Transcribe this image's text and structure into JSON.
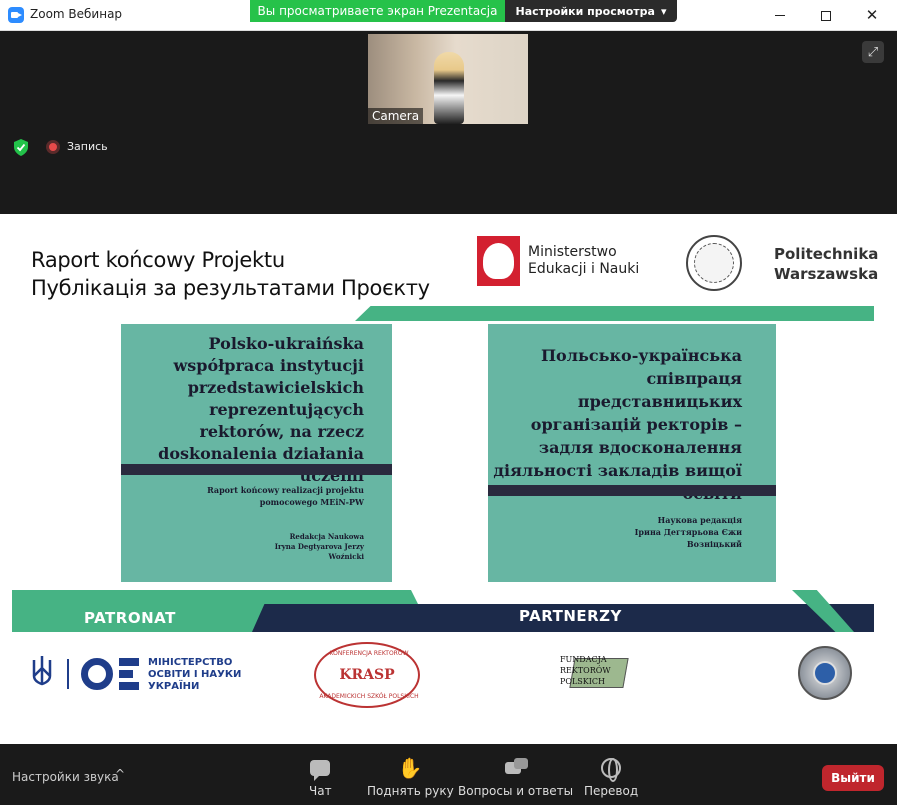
{
  "window": {
    "title": "Zoom Вебинар"
  },
  "share_bar": {
    "viewing_text": "Вы просматриваете экран Prezentacja",
    "view_options_label": "Настройки просмотра",
    "view_options_arrow": "▾"
  },
  "video": {
    "label": "Camera"
  },
  "recording": {
    "label": "Запись"
  },
  "slide": {
    "title_line1": "Raport końcowy Projektu",
    "title_line2": "Публікація за результатами Проєкту",
    "ministry_line1": "Ministerstwo",
    "ministry_line2": "Edukacji i Nauki",
    "pw_line1": "Politechnika",
    "pw_line2": "Warszawska",
    "book_pl": {
      "title": "Polsko-ukraińska współpraca instytucji przedstawicielskich reprezentujących rektorów, na rzecz doskonalenia działania uczelni",
      "subtitle": "Raport końcowy realizacji projektu pomocowego MEiN-PW",
      "editors": "Redakcja Naukowa Iryna Degtyarova Jerzy Woźnicki"
    },
    "book_ua": {
      "title": "Польсько-українська співпраця представницьких організацій ректорів – задля вдосконалення діяльності закладів вищої освіти",
      "editors": "Наукова редакція Ірина Дегтярьова Єжи Возніцький"
    },
    "patronat": "PATRONAT",
    "partnerzy": "PARTNERZY",
    "mon_line1": "МІНІСТЕРСТВО",
    "mon_line2": "ОСВІТИ І НАУКИ",
    "mon_line3": "УКРАЇНИ",
    "krasp": "KRASP",
    "krasp_top": "KONFERENCJA REKTORÓW",
    "krasp_bottom": "AKADEMICKICH SZKÓŁ POLSKICH",
    "frp_text": "FUNDACJA REKTORÓW POLSKICH"
  },
  "toolbar": {
    "audio_settings": "Настройки звука",
    "audio_chevron": "^",
    "chat": "Чат",
    "raise_hand": "Поднять руку",
    "qa": "Вопросы и ответы",
    "translation": "Перевод",
    "leave": "Выйти"
  }
}
